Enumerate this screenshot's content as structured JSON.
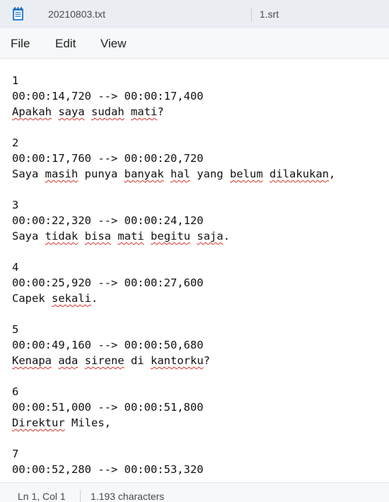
{
  "tabs": [
    {
      "title": "20210803.txt",
      "active": true,
      "icon": "notepad-icon"
    },
    {
      "title": "1.srt",
      "active": false
    }
  ],
  "menu": {
    "file": "File",
    "edit": "Edit",
    "view": "View"
  },
  "colors": {
    "tabbar_bg": "#eaeef2",
    "menubar_bg": "#f6f8fa",
    "spellcheck_underline": "#d9322b",
    "icon_blue": "#2f7fd6"
  },
  "editor": {
    "lines": [
      [
        {
          "t": "1"
        }
      ],
      [
        {
          "t": "00:00:14,720 --> 00:00:17,400"
        }
      ],
      [
        {
          "t": "Apakah",
          "s": true
        },
        {
          "t": " "
        },
        {
          "t": "saya",
          "s": true
        },
        {
          "t": " "
        },
        {
          "t": "sudah",
          "s": true
        },
        {
          "t": " "
        },
        {
          "t": "mati",
          "s": true
        },
        {
          "t": "?"
        }
      ],
      [],
      [
        {
          "t": "2"
        }
      ],
      [
        {
          "t": "00:00:17,760 --> 00:00:20,720"
        }
      ],
      [
        {
          "t": "Saya "
        },
        {
          "t": "masih",
          "s": true
        },
        {
          "t": " punya "
        },
        {
          "t": "banyak",
          "s": true
        },
        {
          "t": " "
        },
        {
          "t": "hal",
          "s": true
        },
        {
          "t": " yang "
        },
        {
          "t": "belum",
          "s": true
        },
        {
          "t": " "
        },
        {
          "t": "dilakukan",
          "s": true
        },
        {
          "t": ","
        }
      ],
      [],
      [
        {
          "t": "3"
        }
      ],
      [
        {
          "t": "00:00:22,320 --> 00:00:24,120"
        }
      ],
      [
        {
          "t": "Saya "
        },
        {
          "t": "tidak",
          "s": true
        },
        {
          "t": " "
        },
        {
          "t": "bisa",
          "s": true
        },
        {
          "t": " "
        },
        {
          "t": "mati",
          "s": true
        },
        {
          "t": " "
        },
        {
          "t": "begitu",
          "s": true
        },
        {
          "t": " "
        },
        {
          "t": "saja",
          "s": true
        },
        {
          "t": "."
        }
      ],
      [],
      [
        {
          "t": "4"
        }
      ],
      [
        {
          "t": "00:00:25,920 --> 00:00:27,600"
        }
      ],
      [
        {
          "t": "Capek "
        },
        {
          "t": "sekali",
          "s": true
        },
        {
          "t": "."
        }
      ],
      [],
      [
        {
          "t": "5"
        }
      ],
      [
        {
          "t": "00:00:49,160 --> 00:00:50,680"
        }
      ],
      [
        {
          "t": "Kenapa",
          "s": true
        },
        {
          "t": " "
        },
        {
          "t": "ada",
          "s": true
        },
        {
          "t": " "
        },
        {
          "t": "sirene",
          "s": true
        },
        {
          "t": " di "
        },
        {
          "t": "kantorku",
          "s": true
        },
        {
          "t": "?"
        }
      ],
      [],
      [
        {
          "t": "6"
        }
      ],
      [
        {
          "t": "00:00:51,000 --> 00:00:51,800"
        }
      ],
      [
        {
          "t": "Direktur",
          "s": true
        },
        {
          "t": " Miles,"
        }
      ],
      [],
      [
        {
          "t": "7"
        }
      ],
      [
        {
          "t": "00:00:52,280 --> 00:00:53,320"
        }
      ]
    ]
  },
  "status": {
    "position": "Ln 1, Col 1",
    "char_count": "1.193 characters"
  }
}
